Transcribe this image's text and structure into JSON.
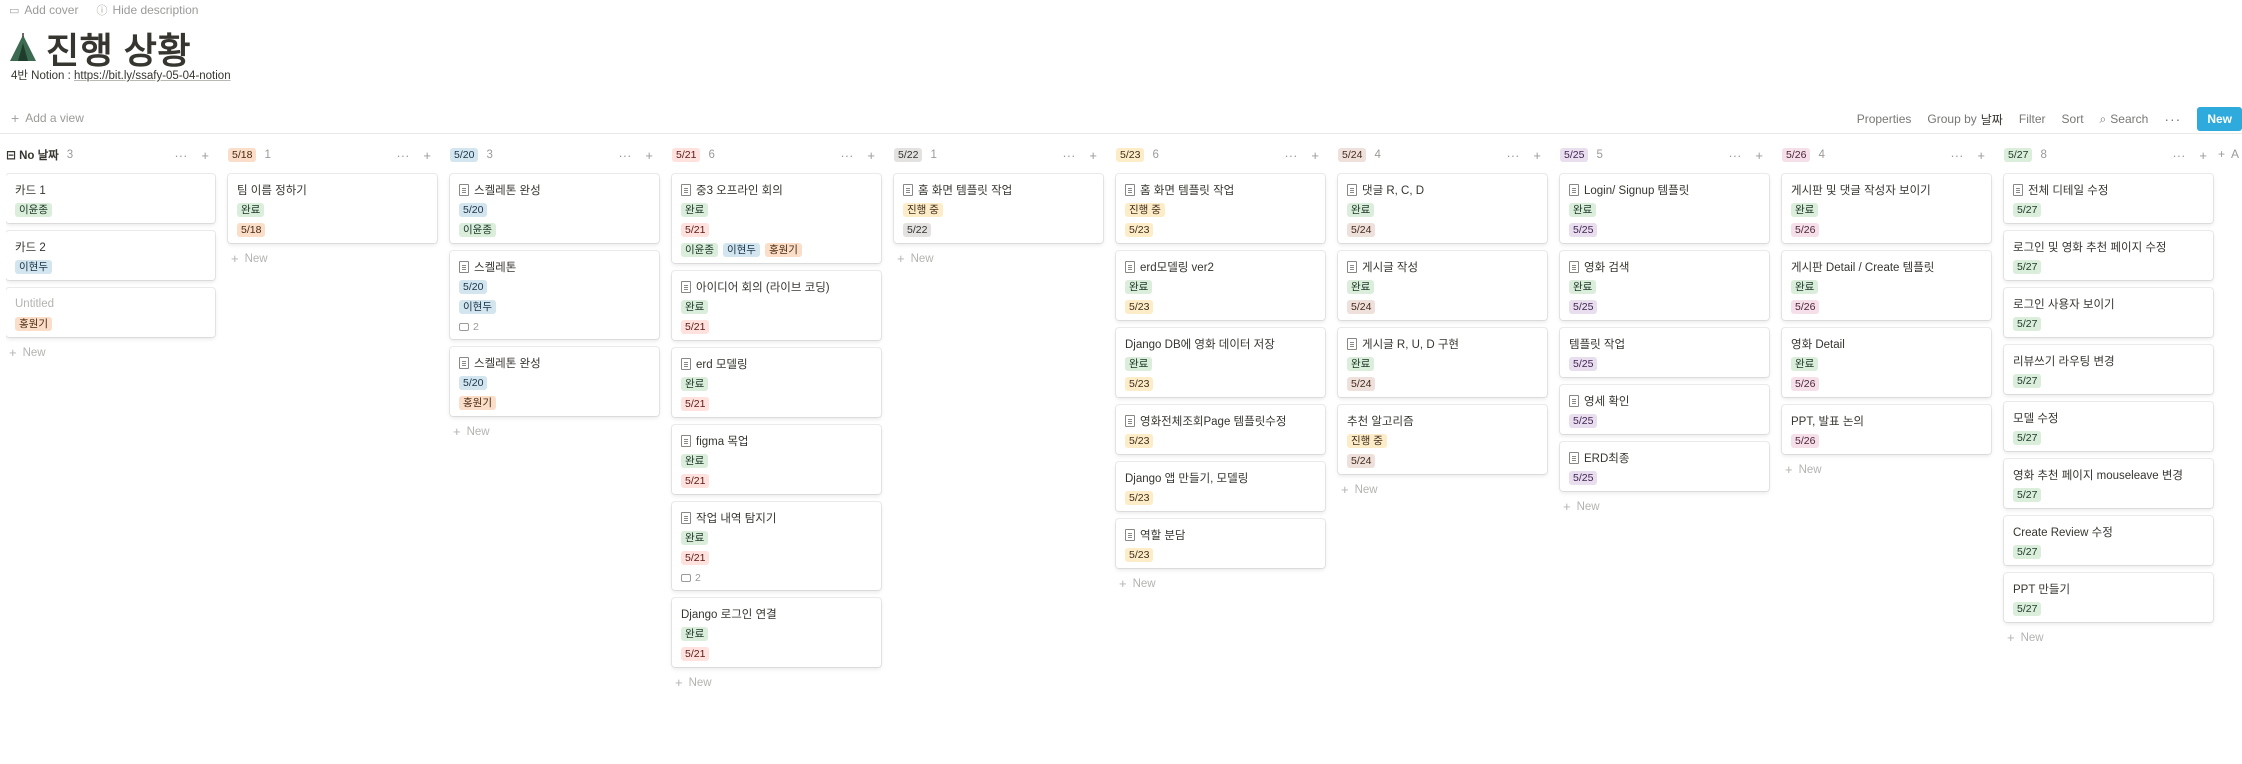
{
  "topbar": {
    "add_cover": "Add cover",
    "hide_description": "Hide description"
  },
  "page": {
    "title": "진행 상황",
    "desc_label": "4반 Notion : ",
    "desc_link": "https://bit.ly/ssafy-05-04-notion"
  },
  "viewbar": {
    "add_view": "Add a view",
    "properties": "Properties",
    "group_by": "Group by",
    "group_value": "날짜",
    "filter": "Filter",
    "sort": "Sort",
    "search": "Search",
    "new": "New"
  },
  "board": {
    "new_label": "New",
    "add_group_label": "A",
    "colors": {
      "green": [
        "#dbeddb",
        "#1c3829"
      ],
      "blue": [
        "#d3e5ef",
        "#183347"
      ],
      "orange": [
        "#fadec9",
        "#49290e"
      ],
      "yellow": [
        "#fdecc8",
        "#402c1b"
      ],
      "red": [
        "#ffe2dd",
        "#5d1715"
      ],
      "purple": [
        "#e8deee",
        "#412454"
      ],
      "pink": [
        "#f5e0e9",
        "#4c2337"
      ],
      "brown": [
        "#eee0da",
        "#442a1e"
      ],
      "gray": [
        "#e3e2e0",
        "#32302c"
      ]
    },
    "columns": [
      {
        "label": "No 날짜",
        "count": "3",
        "color": null,
        "cards": [
          {
            "title": "카드 1",
            "doc": false,
            "muted": false,
            "tags": [
              [
                "이윤종",
                "green"
              ]
            ]
          },
          {
            "title": "카드 2",
            "doc": false,
            "muted": false,
            "tags": [
              [
                "이현두",
                "blue"
              ]
            ]
          },
          {
            "title": "Untitled",
            "doc": false,
            "muted": true,
            "tags": [
              [
                "홍원기",
                "orange"
              ]
            ]
          }
        ]
      },
      {
        "label": "5/18",
        "count": "1",
        "color": "orange",
        "cards": [
          {
            "title": "팀 이름 정하기",
            "doc": false,
            "tags": [
              [
                "완료",
                "green"
              ]
            ],
            "date": "5/18"
          }
        ]
      },
      {
        "label": "5/20",
        "count": "3",
        "color": "blue",
        "cards": [
          {
            "title": "스켈레톤 완성",
            "doc": true,
            "date": "5/20",
            "tags_after": [
              [
                "이윤종",
                "green"
              ]
            ]
          },
          {
            "title": "스켈레톤",
            "doc": true,
            "date": "5/20",
            "tags_after": [
              [
                "이현두",
                "blue"
              ]
            ],
            "comments": "2"
          },
          {
            "title": "스켈레톤 완성",
            "doc": true,
            "date": "5/20",
            "tags_after": [
              [
                "홍원기",
                "orange"
              ]
            ]
          }
        ]
      },
      {
        "label": "5/21",
        "count": "6",
        "color": "red",
        "cards": [
          {
            "title": "중3 오프라인 회의",
            "doc": true,
            "tags": [
              [
                "완료",
                "green"
              ]
            ],
            "date": "5/21",
            "tags_after": [
              [
                "이윤종",
                "green"
              ],
              [
                "이현두",
                "blue"
              ],
              [
                "홍원기",
                "orange"
              ]
            ]
          },
          {
            "title": "아이디어 회의 (라이브 코딩)",
            "doc": true,
            "tags": [
              [
                "완료",
                "green"
              ]
            ],
            "date": "5/21"
          },
          {
            "title": "erd 모델링",
            "doc": true,
            "tags": [
              [
                "완료",
                "green"
              ]
            ],
            "date": "5/21"
          },
          {
            "title": "figma 목업",
            "doc": true,
            "tags": [
              [
                "완료",
                "green"
              ]
            ],
            "date": "5/21"
          },
          {
            "title": "작업 내역 탐지기",
            "doc": true,
            "tags": [
              [
                "완료",
                "green"
              ]
            ],
            "date": "5/21",
            "comments": "2"
          },
          {
            "title": "Django 로그인 연결",
            "doc": false,
            "tags": [
              [
                "완료",
                "green"
              ]
            ],
            "date": "5/21"
          }
        ]
      },
      {
        "label": "5/22",
        "count": "1",
        "color": "gray",
        "cards": [
          {
            "title": "홈 화면 템플릿 작업",
            "doc": true,
            "tags": [
              [
                "진행 중",
                "yellow"
              ]
            ],
            "date": "5/22"
          }
        ]
      },
      {
        "label": "5/23",
        "count": "6",
        "color": "yellow",
        "cards": [
          {
            "title": "홈 화면 템플릿 작업",
            "doc": true,
            "tags": [
              [
                "진행 중",
                "yellow"
              ]
            ],
            "date": "5/23"
          },
          {
            "title": "erd모델링 ver2",
            "doc": true,
            "tags": [
              [
                "완료",
                "green"
              ]
            ],
            "date": "5/23"
          },
          {
            "title": "Django DB에 영화 데이터 저장",
            "doc": false,
            "tags": [
              [
                "완료",
                "green"
              ]
            ],
            "date": "5/23"
          },
          {
            "title": "영화전체조회Page 템플릿수정",
            "doc": true,
            "date": "5/23"
          },
          {
            "title": "Django 앱 만들기, 모델링",
            "doc": false,
            "date": "5/23"
          },
          {
            "title": "역할 분담",
            "doc": true,
            "date": "5/23"
          }
        ]
      },
      {
        "label": "5/24",
        "count": "4",
        "color": "brown",
        "cards": [
          {
            "title": "댓글 R, C, D",
            "doc": true,
            "tags": [
              [
                "완료",
                "green"
              ]
            ],
            "date": "5/24"
          },
          {
            "title": "게시글 작성",
            "doc": true,
            "tags": [
              [
                "완료",
                "green"
              ]
            ],
            "date": "5/24"
          },
          {
            "title": "게시글 R, U, D 구현",
            "doc": true,
            "tags": [
              [
                "완료",
                "green"
              ]
            ],
            "date": "5/24"
          },
          {
            "title": "추천 알고리즘",
            "doc": false,
            "tags": [
              [
                "진행 중",
                "yellow"
              ]
            ],
            "date": "5/24"
          }
        ]
      },
      {
        "label": "5/25",
        "count": "5",
        "color": "purple",
        "cards": [
          {
            "title": "Login/ Signup 템플릿",
            "doc": true,
            "tags": [
              [
                "완료",
                "green"
              ]
            ],
            "date": "5/25"
          },
          {
            "title": "영화 검색",
            "doc": true,
            "tags": [
              [
                "완료",
                "green"
              ]
            ],
            "date": "5/25"
          },
          {
            "title": "템플릿 작업",
            "doc": false,
            "date": "5/25"
          },
          {
            "title": "영세 확인",
            "doc": true,
            "date": "5/25"
          },
          {
            "title": "ERD최종",
            "doc": true,
            "date": "5/25"
          }
        ]
      },
      {
        "label": "5/26",
        "count": "4",
        "color": "pink",
        "cards": [
          {
            "title": "게시판 및 댓글 작성자 보이기",
            "doc": false,
            "tags": [
              [
                "완료",
                "green"
              ]
            ],
            "date": "5/26"
          },
          {
            "title": "게시판 Detail / Create 템플릿",
            "doc": false,
            "tags": [
              [
                "완료",
                "green"
              ]
            ],
            "date": "5/26"
          },
          {
            "title": "영화 Detail",
            "doc": false,
            "tags": [
              [
                "완료",
                "green"
              ]
            ],
            "date": "5/26"
          },
          {
            "title": "PPT, 발표 논의",
            "doc": false,
            "date": "5/26"
          }
        ]
      },
      {
        "label": "5/27",
        "count": "8",
        "color": "green",
        "cards": [
          {
            "title": "전체 디테일 수정",
            "doc": true,
            "date": "5/27"
          },
          {
            "title": "로그인 및 영화 추천 페이지 수정",
            "doc": false,
            "date": "5/27"
          },
          {
            "title": "로그인 사용자 보이기",
            "doc": false,
            "date": "5/27"
          },
          {
            "title": "리뷰쓰기 라우팅 변경",
            "doc": false,
            "date": "5/27"
          },
          {
            "title": "모델 수정",
            "doc": false,
            "date": "5/27"
          },
          {
            "title": "영화 추천 페이지 mouseleave 변경",
            "doc": false,
            "date": "5/27"
          },
          {
            "title": "Create Review 수정",
            "doc": false,
            "date": "5/27"
          },
          {
            "title": "PPT 만들기",
            "doc": false,
            "date": "5/27"
          }
        ]
      }
    ]
  }
}
